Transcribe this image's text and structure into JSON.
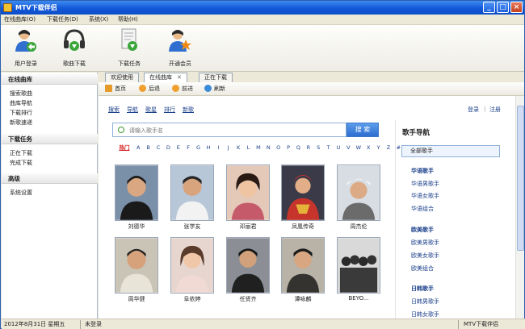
{
  "window": {
    "title": "MTV下载伴侣"
  },
  "menu": [
    "在线曲库(O)",
    "下载任务(D)",
    "系统(X)",
    "帮助(H)"
  ],
  "toolbar": [
    {
      "label": "用户登录",
      "icon": "user-login-icon"
    },
    {
      "label": "歌曲下载",
      "icon": "headphones-icon"
    },
    {
      "label": "下载任务",
      "icon": "download-task-icon"
    },
    {
      "label": "开通会员",
      "icon": "member-star-icon"
    }
  ],
  "sidebar": {
    "sections": [
      {
        "title": "在线曲库",
        "items": [
          "搜索歌曲",
          "曲库导航",
          "下载排行",
          "新歌速递"
        ]
      },
      {
        "title": "下载任务",
        "items": [
          "正在下载",
          "完成下载"
        ]
      },
      {
        "title": "高级",
        "items": [
          "系统设置"
        ]
      }
    ]
  },
  "tabs": [
    {
      "label": "欢迎使用",
      "closable": false,
      "active": false
    },
    {
      "label": "在线曲库",
      "closable": true,
      "active": true
    },
    {
      "label": "正在下载",
      "closable": false,
      "active": false
    }
  ],
  "nav": [
    {
      "label": "首页",
      "icon": "home-icon"
    },
    {
      "label": "后退",
      "icon": "back-icon"
    },
    {
      "label": "前进",
      "icon": "forward-icon"
    },
    {
      "label": "刷新",
      "icon": "refresh-icon"
    }
  ],
  "categories": [
    "搜索",
    "导航",
    "歌星",
    "排行",
    "新歌"
  ],
  "account": {
    "login": "登录",
    "sep": "|",
    "register": "注册"
  },
  "search": {
    "placeholder": "请输入歌手名",
    "button": "搜 索"
  },
  "letters": {
    "hot": "热门",
    "list": [
      "A",
      "B",
      "C",
      "D",
      "E",
      "F",
      "G",
      "H",
      "I",
      "J",
      "K",
      "L",
      "M",
      "N",
      "O",
      "P",
      "Q",
      "R",
      "S",
      "T",
      "U",
      "V",
      "W",
      "X",
      "Y",
      "Z",
      "#"
    ]
  },
  "artists": [
    "刘德华",
    "张学友",
    "邓丽君",
    "凤凰传奇",
    "周杰伦",
    "周华健",
    "阜依婷",
    "任贤齐",
    "谭咏麟",
    "BEYO..."
  ],
  "right_panel": {
    "title": "歌手导航",
    "selected": "全部歌手",
    "groups": [
      {
        "name": "华语歌手",
        "items": [
          "华语男歌手",
          "华语女歌手",
          "华语组合"
        ]
      },
      {
        "name": "欧美歌手",
        "items": [
          "欧美男歌手",
          "欧美女歌手",
          "欧美组合"
        ]
      },
      {
        "name": "日韩歌手",
        "items": [
          "日韩男歌手",
          "日韩女歌手"
        ]
      }
    ]
  },
  "status": {
    "date": "2012年8月31日 星期五",
    "login": "未登录",
    "app": "MTV下载伴侣"
  },
  "colors": {
    "title_bar": "#1358d8",
    "link": "#1a3f8a",
    "hot": "#d61f1f",
    "search_button": "#2d6ed0"
  }
}
